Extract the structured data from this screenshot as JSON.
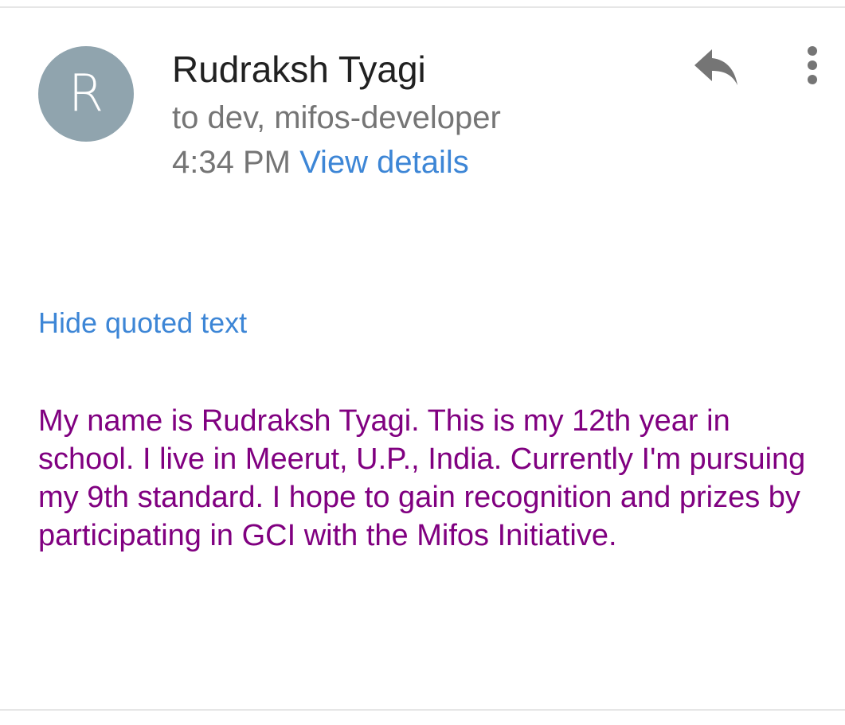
{
  "message": {
    "avatar_letter": "R",
    "sender_name": "Rudraksh Tyagi",
    "recipients": "to dev, mifos-developer",
    "time": "4:34 PM",
    "view_details_label": "View details",
    "hide_quoted_label": "Hide quoted text",
    "body": "My name is Rudraksh Tyagi. This is my 12th year in school. I live in Meerut, U.P., India. Currently I'm pursuing my 9th standard. I hope to gain recognition and prizes by participating in GCI with the Mifos Initiative."
  },
  "icons": {
    "reply": "reply-icon",
    "more": "more-vert-icon"
  },
  "colors": {
    "avatar_bg": "#90a4ae",
    "link": "#3d86d6",
    "body_text": "#800080",
    "secondary_text": "#757575",
    "primary_text": "#212121",
    "icon": "#757575"
  }
}
